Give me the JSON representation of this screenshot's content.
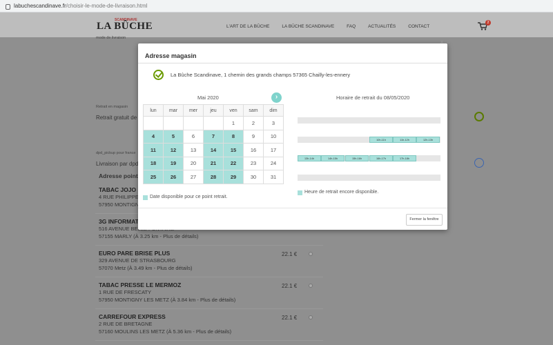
{
  "browser": {
    "url_domain": "labuchescandinave.fr",
    "url_path": "/choisir-le-mode-de-livraison.html"
  },
  "header": {
    "logo": "LA BÛCHE",
    "logo_sub": "SCANDINAVE",
    "nav": [
      "L'ART DE LA BÛCHE",
      "LA BÛCHE SCANDINAVE",
      "FAQ",
      "ACTUALITÉS",
      "CONTACT"
    ],
    "cart_count": "2"
  },
  "background": {
    "mode_label_top": "mode de livraison",
    "store_pickup_small": "Retrait en magasin",
    "store_pickup_text": "Retrait gratuit de votre commande",
    "dpd_small": "dpd_pickup pour france",
    "dpd_text": "Livraison par dpd en point relais",
    "table_header": "Adresse point relais",
    "stores": [
      {
        "name": "TABAC JOJO",
        "line1": "4 RUE PHILIPPE CONRAD",
        "line2": "57950 MONTIGNY LES METZ",
        "price": "",
        "distance": ""
      },
      {
        "name": "3G INFORMATIQUE",
        "line1": "516 AVENUE BELLE FONTAINE",
        "line2": "57155 MARLY (À",
        "price": "",
        "distance": "3.25 km - Plus de détails)"
      },
      {
        "name": "EURO PARE BRISE PLUS",
        "line1": "329 AVENUE DE STRASBOURG",
        "line2": "57070 Metz (À",
        "price": "22.1 €",
        "distance": "3.49 km - Plus de détails)"
      },
      {
        "name": "TABAC PRESSE LE MERMOZ",
        "line1": "1 RUE DE FRESCATY",
        "line2": "57950 MONTIGNY LES METZ (À",
        "price": "22.1 €",
        "distance": "3.84 km - Plus de détails)"
      },
      {
        "name": "CARREFOUR EXPRESS",
        "line1": "2 RUE DE BRETAGNE",
        "line2": "57160 MOULINS LES METZ (À",
        "price": "22.1 €",
        "distance": "5.36 km - Plus de détails)"
      }
    ]
  },
  "modal": {
    "close_glyph": "x",
    "title": "Adresse magasin",
    "address": "La Bûche Scandinave, 1 chemin des grands champs 57365 Chailly-les-ennery",
    "calendar": {
      "month": "Mai 2020",
      "next_glyph": "›",
      "weekdays": [
        "lun",
        "mar",
        "mer",
        "jeu",
        "ven",
        "sam",
        "dim"
      ],
      "weeks": [
        [
          "",
          "",
          "",
          "",
          "1",
          "2",
          "3"
        ],
        [
          "4",
          "5",
          "6",
          "7",
          "8",
          "9",
          "10"
        ],
        [
          "11",
          "12",
          "13",
          "14",
          "15",
          "16",
          "17"
        ],
        [
          "18",
          "19",
          "20",
          "21",
          "22",
          "23",
          "24"
        ],
        [
          "25",
          "26",
          "27",
          "28",
          "29",
          "30",
          "31"
        ]
      ],
      "available_days": [
        "4",
        "5",
        "7",
        "8",
        "11",
        "12",
        "14",
        "15",
        "18",
        "19",
        "21",
        "22",
        "25",
        "26",
        "28",
        "29"
      ],
      "legend": "Date disponible pour ce point retrait."
    },
    "schedule": {
      "title": "Horaire de retrait du 08/05/2020",
      "rows": [
        [],
        [
          "10h-11h",
          "11h-12h",
          "12h-13h"
        ],
        [
          "13h-14h",
          "14h-15h",
          "15h-16h",
          "16h-17h",
          "17h-18h"
        ],
        []
      ],
      "legend": "Heure de retrait encore disponible."
    },
    "close_button": "Fermer la fenêtre"
  },
  "colors": {
    "available": "#a8e0db",
    "check_green": "#6a9a00",
    "cart_badge": "#c0392b"
  }
}
